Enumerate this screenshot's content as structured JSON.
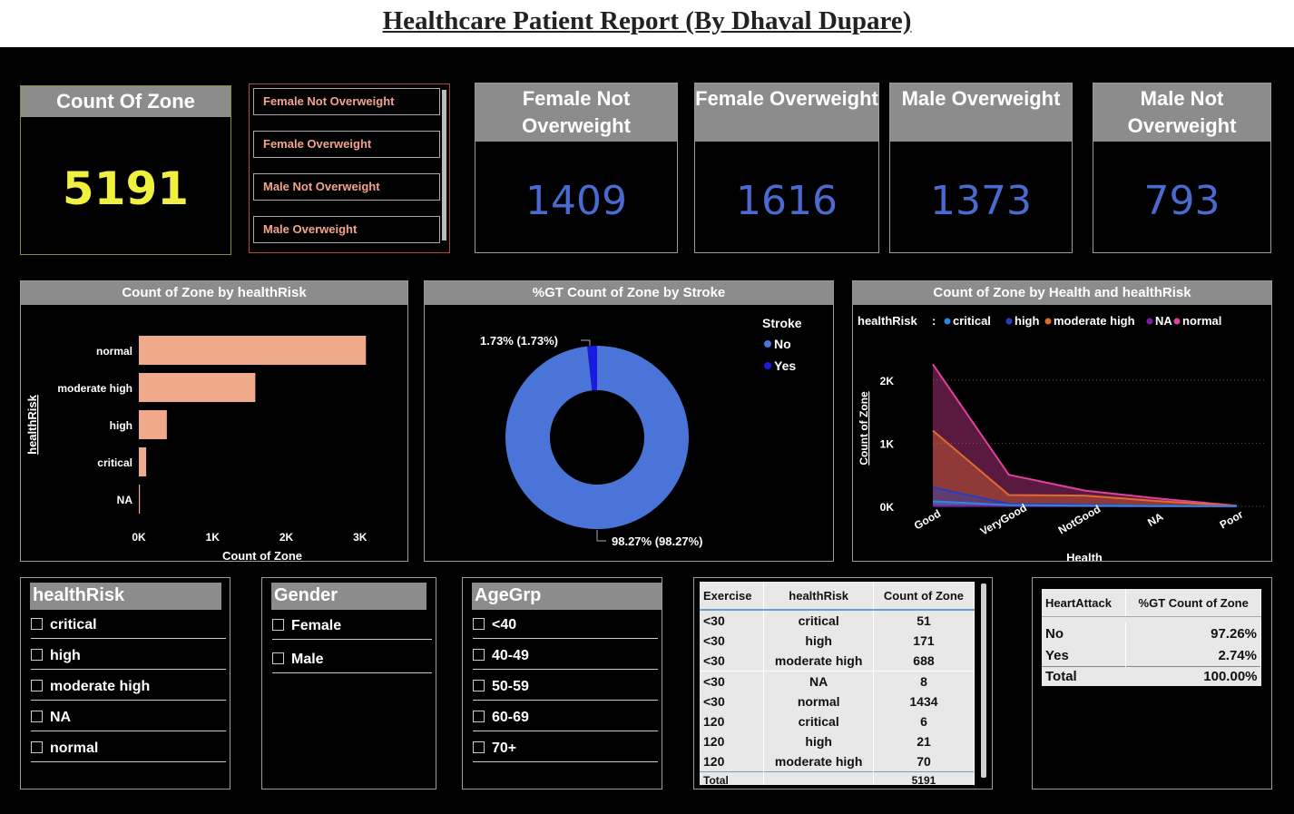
{
  "page_title": "Healthcare Patient Report (By Dhaval Dupare)",
  "count_card": {
    "title": "Count Of Zone",
    "value": "5191"
  },
  "category_slicer": [
    "Female Not Overweight",
    "Female Overweight",
    "Male Not Overweight",
    "Male Overweight"
  ],
  "kpis": [
    {
      "title": "Female Not Overweight",
      "value": "1409"
    },
    {
      "title": "Female Overweight",
      "value": "1616"
    },
    {
      "title": "Male Overweight",
      "value": "1373"
    },
    {
      "title": "Male Not Overweight",
      "value": "793"
    }
  ],
  "bar_chart": {
    "title": "Count of Zone by healthRisk",
    "xlabel": "Count of Zone",
    "ylabel": "healthRisk",
    "ticks": [
      "0K",
      "1K",
      "2K",
      "3K"
    ]
  },
  "donut": {
    "title": "%GT Count of Zone by Stroke",
    "legend_title": "Stroke",
    "labels": [
      "1.73% (1.73%)",
      "98.27% (98.27%)"
    ]
  },
  "area_chart": {
    "title": "Count of Zone by Health and healthRisk",
    "legend_title": "healthRisk",
    "legend_sep": ":",
    "xlabel": "Health",
    "ylabel": "Count of Zone",
    "yticks": [
      "2K",
      "1K",
      "0K"
    ]
  },
  "chart_data": [
    {
      "type": "bar",
      "title": "Count of Zone by healthRisk",
      "xlabel": "Count of Zone",
      "ylabel": "healthRisk",
      "categories": [
        "normal",
        "moderate high",
        "high",
        "critical",
        "NA"
      ],
      "values": [
        3080,
        1580,
        380,
        100,
        15
      ],
      "xlim": [
        0,
        3200
      ],
      "color": "#f0a98a"
    },
    {
      "type": "pie",
      "title": "%GT Count of Zone by Stroke",
      "categories": [
        "No",
        "Yes"
      ],
      "values": [
        98.27,
        1.73
      ],
      "colors": [
        "#4a74d8",
        "#1a1ae0"
      ]
    },
    {
      "type": "area",
      "title": "Count of Zone by Health and healthRisk",
      "xlabel": "Health",
      "ylabel": "Count of Zone",
      "categories": [
        "Good",
        "VeryGood",
        "NotGood",
        "NA",
        "Poor"
      ],
      "ylim": [
        0,
        2500
      ],
      "series": [
        {
          "name": "normal",
          "color": "#e040a0",
          "values": [
            2250,
            500,
            250,
            120,
            10
          ]
        },
        {
          "name": "moderate high",
          "color": "#e06a30",
          "values": [
            1200,
            180,
            170,
            80,
            5
          ]
        },
        {
          "name": "NA",
          "color": "#7b1fa2",
          "values": [
            5,
            5,
            3,
            2,
            1
          ]
        },
        {
          "name": "high",
          "color": "#2040c0",
          "values": [
            300,
            40,
            25,
            10,
            2
          ]
        },
        {
          "name": "critical",
          "color": "#2e86de",
          "values": [
            80,
            20,
            10,
            5,
            1
          ]
        }
      ],
      "legend_order": [
        "critical",
        "high",
        "moderate high",
        "NA",
        "normal"
      ]
    }
  ],
  "filters": {
    "healthRisk": {
      "title": "healthRisk",
      "items": [
        "critical",
        "high",
        "moderate high",
        "NA",
        "normal"
      ]
    },
    "gender": {
      "title": "Gender",
      "items": [
        "Female",
        "Male"
      ]
    },
    "agegrp": {
      "title": "AgeGrp",
      "items": [
        "<40",
        "40-49",
        "50-59",
        "60-69",
        "70+"
      ]
    }
  },
  "exercise_table": {
    "headers": [
      "Exercise",
      "healthRisk",
      "Count of Zone"
    ],
    "rows": [
      [
        "<30",
        "critical",
        "51"
      ],
      [
        "<30",
        "high",
        "171"
      ],
      [
        "<30",
        "moderate high",
        "688"
      ],
      [
        "<30",
        "NA",
        "8"
      ],
      [
        "<30",
        "normal",
        "1434"
      ],
      [
        "120",
        "critical",
        "6"
      ],
      [
        "120",
        "high",
        "21"
      ],
      [
        "120",
        "moderate high",
        "70"
      ]
    ],
    "total": [
      "Total",
      "",
      "5191"
    ]
  },
  "heart_table": {
    "headers": [
      "HeartAttack",
      "%GT Count of Zone"
    ],
    "rows": [
      [
        "No",
        "97.26%"
      ],
      [
        "Yes",
        "2.74%"
      ]
    ],
    "total": [
      "Total",
      "100.00%"
    ]
  },
  "colors": {
    "accent_yellow": "#f0f040",
    "kpi_blue": "#4a6ad0",
    "slicer_text": "#f4a48a"
  }
}
